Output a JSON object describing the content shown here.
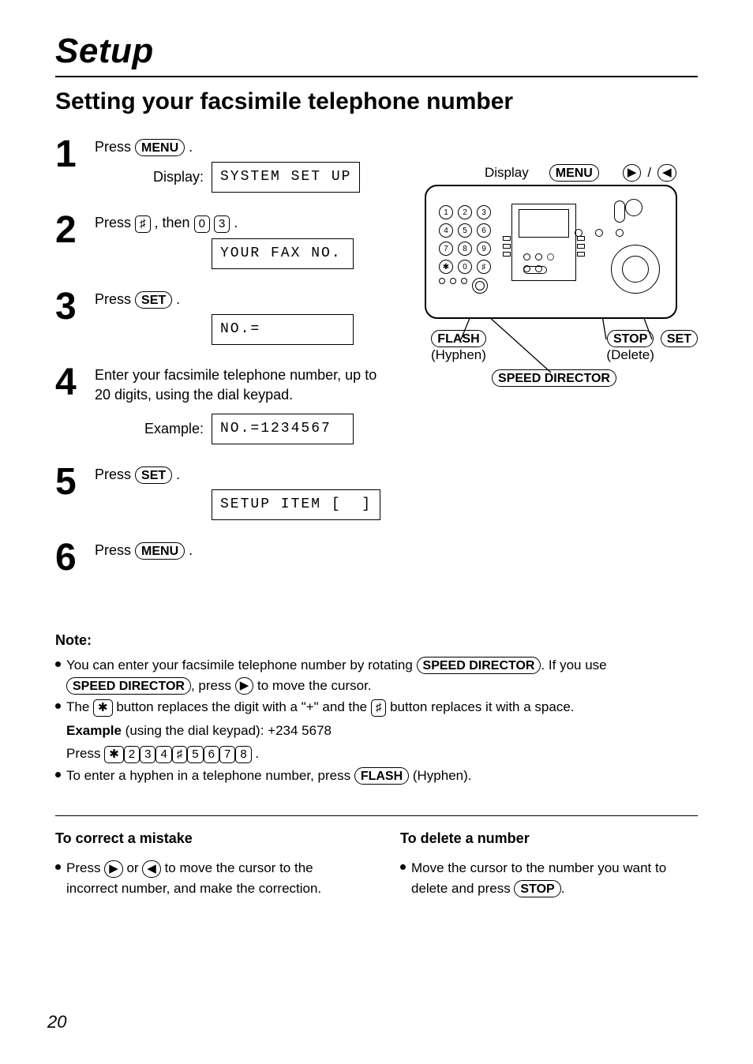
{
  "page": {
    "number": "20"
  },
  "title": "Setup",
  "heading": "Setting your facsimile telephone number",
  "steps": {
    "s1": {
      "num": "1",
      "text_prefix": "Press ",
      "btn": "MENU",
      "display_label": "Display:",
      "lcd": "SYSTEM SET UP"
    },
    "s2": {
      "num": "2",
      "text_prefix": "Press ",
      "key1": "♯",
      "mid": " , then ",
      "key2": "0",
      "key3": "3",
      "lcd": "YOUR FAX NO."
    },
    "s3": {
      "num": "3",
      "text_prefix": "Press ",
      "btn": "SET",
      "lcd": "NO.="
    },
    "s4": {
      "num": "4",
      "text": "Enter your facsimile telephone number, up to 20 digits, using the dial keypad.",
      "example_label": "Example:",
      "lcd": "NO.=1234567"
    },
    "s5": {
      "num": "5",
      "text_prefix": "Press ",
      "btn": "SET",
      "lcd": "SETUP ITEM [  ]"
    },
    "s6": {
      "num": "6",
      "text_prefix": "Press ",
      "btn": "MENU"
    }
  },
  "diagram": {
    "display": "Display",
    "menu": "MENU",
    "flash": "FLASH",
    "hyphen": "(Hyphen)",
    "stop": "STOP",
    "delete": "(Delete)",
    "set": "SET",
    "speed": "SPEED DIRECTOR"
  },
  "note": {
    "heading": "Note:",
    "b1_a": "You can enter your facsimile telephone number by rotating ",
    "b1_btn1": "SPEED DIRECTOR",
    "b1_b": ". If you use ",
    "b1_btn2": "SPEED DIRECTOR",
    "b1_c": ", press ",
    "b1_arrow": "▶",
    "b1_d": " to move the cursor.",
    "b2_a": "The ",
    "b2_k1": "✱",
    "b2_b": " button replaces the digit with a \"+\" and the ",
    "b2_k2": "♯",
    "b2_c": " button replaces it with a space.",
    "example_label": "Example",
    "example_text": " (using the dial keypad):  +234  5678",
    "press": "Press ",
    "seq": [
      "✱",
      "2",
      "3",
      "4",
      "♯",
      "5",
      "6",
      "7",
      "8"
    ],
    "b3_a": "To enter a hyphen in a telephone number, press ",
    "b3_btn": "FLASH",
    "b3_b": " (Hyphen)."
  },
  "correct": {
    "heading": "To correct a mistake",
    "b1_a": "Press ",
    "b1_ar": "▶",
    "b1_b": " or ",
    "b1_al": "◀",
    "b1_c": " to move the cursor to the incorrect number, and make the correction."
  },
  "delete": {
    "heading": "To delete a number",
    "b1_a": "Move the cursor to the number you want to delete and press ",
    "b1_btn": "STOP",
    "b1_b": "."
  }
}
